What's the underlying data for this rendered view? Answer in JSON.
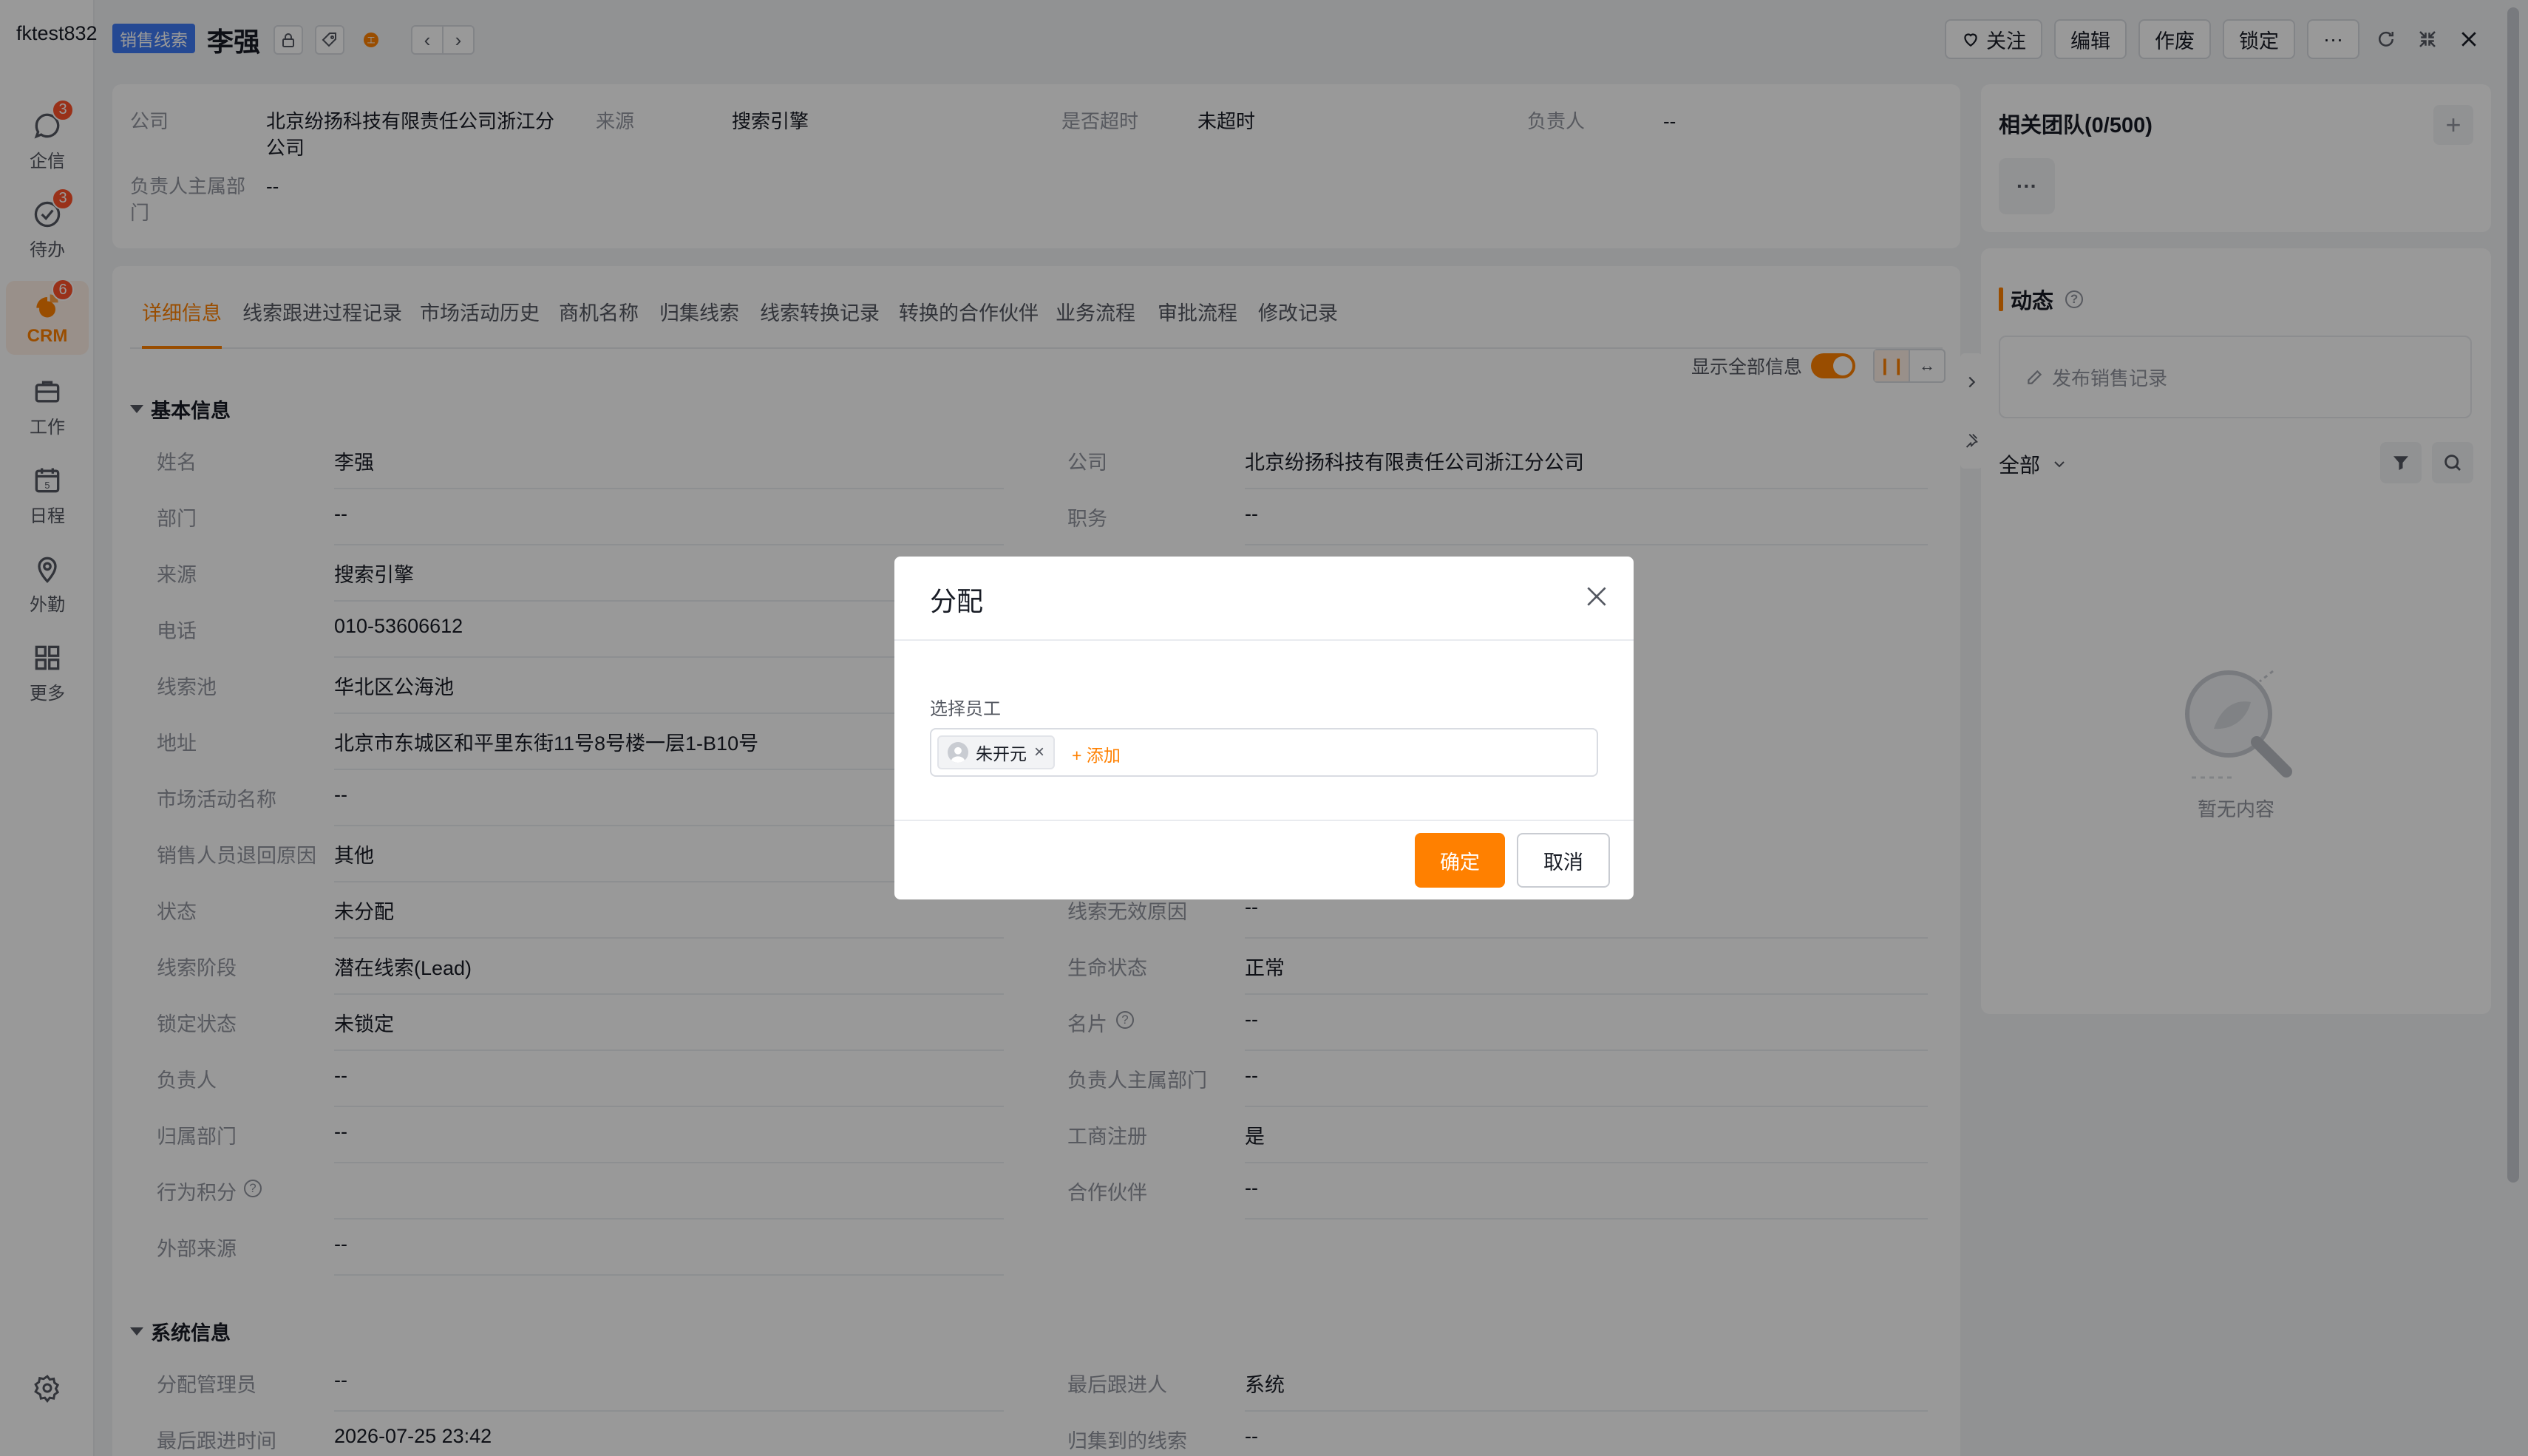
{
  "nav": {
    "user": "fktest832",
    "items": [
      {
        "label": "企信",
        "icon": "chat-icon",
        "badge": "3"
      },
      {
        "label": "待办",
        "icon": "todo-icon",
        "badge": "3"
      },
      {
        "label": "CRM",
        "icon": "crm-icon",
        "badge": "6"
      },
      {
        "label": "工作",
        "icon": "briefcase-icon",
        "badge": ""
      },
      {
        "label": "日程",
        "icon": "calendar-icon",
        "badge": ""
      },
      {
        "label": "外勤",
        "icon": "location-icon",
        "badge": ""
      },
      {
        "label": "更多",
        "icon": "grid-icon",
        "badge": ""
      }
    ]
  },
  "header": {
    "tag": "销售线索",
    "title": "李强",
    "actions": {
      "follow": "关注",
      "edit": "编辑",
      "void": "作废",
      "lock": "锁定",
      "more": "···"
    }
  },
  "summary": {
    "company_label": "公司",
    "company_value": "北京纷扬科技有限责任公司浙江分公司",
    "source_label": "来源",
    "source_value": "搜索引擎",
    "timeout_label": "是否超时",
    "timeout_value": "未超时",
    "owner_label": "负责人",
    "owner_value": "--",
    "dept_label": "负责人主属部门",
    "dept_value": "--"
  },
  "tabs": [
    "详细信息",
    "线索跟进过程记录",
    "市场活动历史",
    "商机名称",
    "归集线索",
    "线索转换记录",
    "转换的合作伙伴",
    "业务流程",
    "审批流程",
    "修改记录"
  ],
  "toggle_label": "显示全部信息",
  "basic": {
    "title": "基本信息",
    "left": [
      {
        "label": "姓名",
        "value": "李强"
      },
      {
        "label": "部门",
        "value": "--"
      },
      {
        "label": "来源",
        "value": "搜索引擎"
      },
      {
        "label": "电话",
        "value": "010-53606612"
      },
      {
        "label": "线索池",
        "value": "华北区公海池"
      },
      {
        "label": "地址",
        "value": "北京市东城区和平里东街11号8号楼一层1-B10号"
      },
      {
        "label": "市场活动名称",
        "value": "--"
      },
      {
        "label": "销售人员退回原因",
        "value": "其他"
      },
      {
        "label": "状态",
        "value": "未分配"
      },
      {
        "label": "线索阶段",
        "value": "潜在线索(Lead)"
      },
      {
        "label": "锁定状态",
        "value": "未锁定"
      },
      {
        "label": "负责人",
        "value": "--"
      },
      {
        "label": "归属部门",
        "value": "--"
      },
      {
        "label": "行为积分",
        "value": ""
      },
      {
        "label": "外部来源",
        "value": "--"
      }
    ],
    "right": [
      {
        "label": "公司",
        "value": "北京纷扬科技有限责任公司浙江分公司"
      },
      {
        "label": "职务",
        "value": "--"
      },
      {
        "label": "线索无效原因",
        "value": "--"
      },
      {
        "label": "生命状态",
        "value": "正常"
      },
      {
        "label": "名片",
        "value": "--"
      },
      {
        "label": "负责人主属部门",
        "value": "--"
      },
      {
        "label": "工商注册",
        "value": "是"
      },
      {
        "label": "合作伙伴",
        "value": "--"
      }
    ]
  },
  "system": {
    "title": "系统信息",
    "left": [
      {
        "label": "分配管理员",
        "value": "--"
      },
      {
        "label": "最后跟进时间",
        "value": "2026-07-25 23:42"
      }
    ],
    "right": [
      {
        "label": "最后跟进人",
        "value": "系统"
      },
      {
        "label": "归集到的线索",
        "value": "--"
      }
    ]
  },
  "team": {
    "title": "相关团队(0/500)",
    "more": "···"
  },
  "activity": {
    "title": "动态",
    "post_placeholder": "发布销售记录",
    "filter": "全部",
    "empty": "暂无内容"
  },
  "modal": {
    "title": "分配",
    "field_label": "选择员工",
    "selected": "朱开元",
    "add": "+ 添加",
    "confirm": "确定",
    "cancel": "取消"
  },
  "colors": {
    "accent": "#ff8000",
    "tag": "#3e7af5",
    "badge": "#ff522a"
  }
}
